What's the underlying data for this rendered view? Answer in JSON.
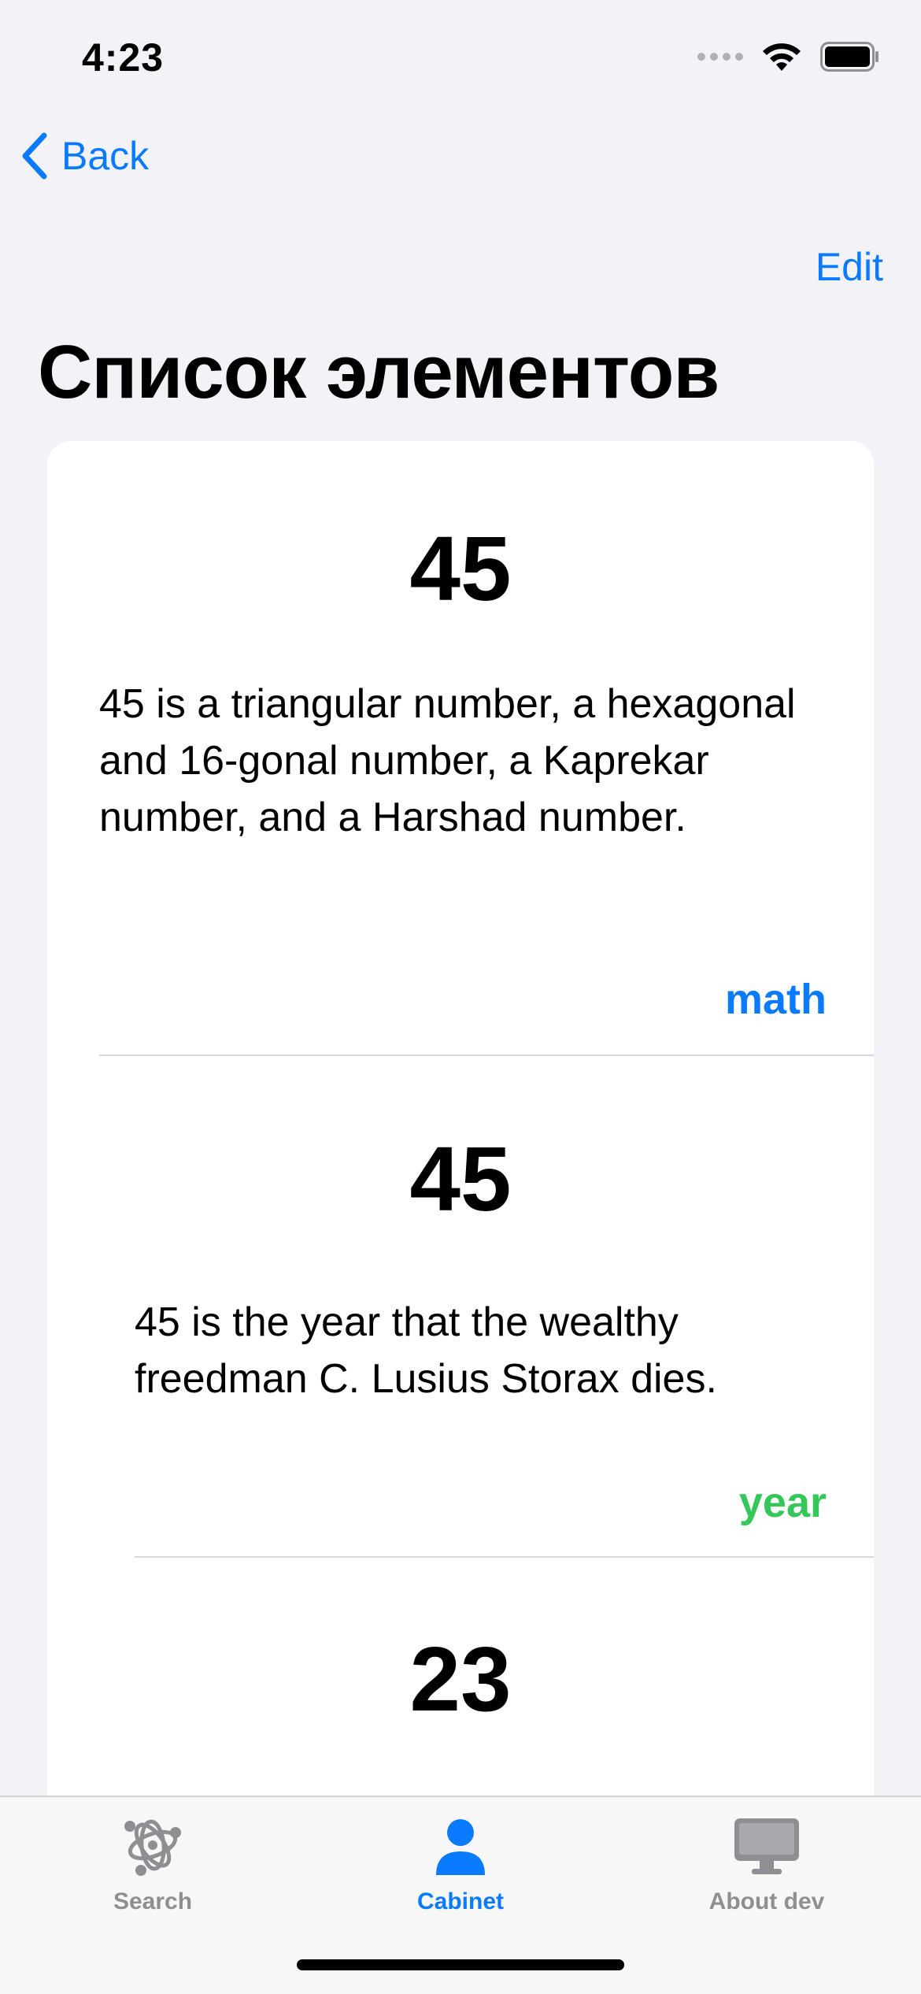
{
  "status_bar": {
    "time": "4:23",
    "icons": [
      "cellular-signal-icon",
      "wifi-icon",
      "battery-icon"
    ]
  },
  "nav": {
    "back_label": "Back",
    "edit_label": "Edit"
  },
  "page": {
    "title": "Список элементов"
  },
  "items": [
    {
      "number": "45",
      "text": "45 is a triangular number, a hexagonal and 16-gonal number, a Kaprekar number, and a Harshad number.",
      "category": "math",
      "category_color": "#0A7AFF"
    },
    {
      "number": "45",
      "text": "45 is the year that the wealthy freedman C. Lusius Storax dies.",
      "category": "year",
      "category_color": "#34C759"
    },
    {
      "number": "23"
    }
  ],
  "tab_bar": {
    "tabs": [
      {
        "label": "Search",
        "icon": "search-molecule-icon",
        "selected": false
      },
      {
        "label": "Cabinet",
        "icon": "person-icon",
        "selected": true
      },
      {
        "label": "About dev",
        "icon": "monitor-icon",
        "selected": false
      }
    ]
  },
  "colors": {
    "accent": "#0A7AFF",
    "year": "#34C759",
    "background": "#F2F2F7",
    "inactive": "#8E8E93"
  }
}
